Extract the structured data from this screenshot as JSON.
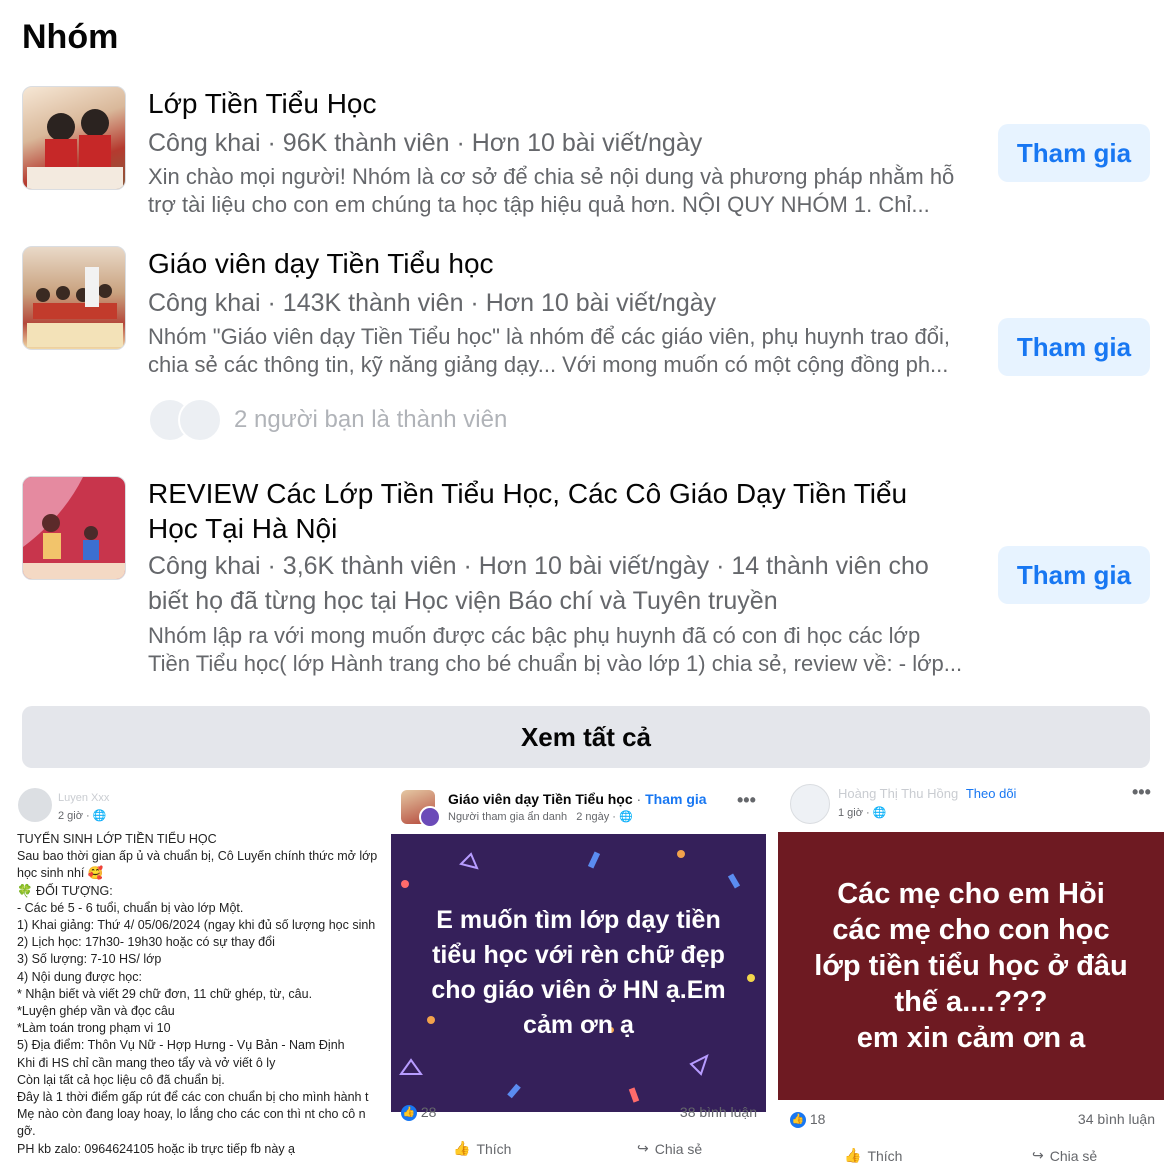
{
  "section": {
    "title": "Nhóm"
  },
  "groups": [
    {
      "name": "Lớp Tiền Tiểu Học",
      "meta": "Công khai · 96K thành viên · Hơn 10 bài viết/ngày",
      "desc1": "Xin chào mọi người! Nhóm là cơ sở để chia sẻ nội dung và phương pháp nhằm hỗ",
      "desc2": "trợ tài liệu cho con em chúng ta học tập hiệu quả hơn. NỘI QUY NHÓM 1. Chỉ...",
      "join": "Tham gia"
    },
    {
      "name": "Giáo viên dạy Tiền Tiểu học",
      "meta": "Công khai · 143K thành viên · Hơn 10 bài viết/ngày",
      "desc1": "Nhóm \"Giáo viên dạy Tiền Tiểu học\" là nhóm để các giáo viên, phụ huynh trao đổi,",
      "desc2": "chia sẻ các thông tin, kỹ năng giảng dạy... Với mong muốn có một cộng đồng ph...",
      "friends": "2 người bạn là thành viên",
      "join": "Tham gia"
    },
    {
      "name1": "REVIEW Các Lớp Tiền Tiểu Học, Các Cô Giáo Dạy Tiền Tiểu",
      "name2": "Học Tại Hà Nội",
      "meta1": "Công khai · 3,6K thành viên · Hơn 10 bài viết/ngày · 14 thành viên cho",
      "meta2": "biết họ đã từng học tại Học viện Báo chí và Tuyên truyền",
      "desc1": "Nhóm lập ra với mong muốn được các bậc phụ huynh đã có con đi học các lớp",
      "desc2": "Tiền Tiểu học( lớp Hành trang cho bé chuẩn bị vào lớp 1) chia sẻ, review về: - lớp...",
      "join": "Tham gia"
    }
  ],
  "see_all": "Xem tất cả",
  "posts": [
    {
      "author": "Luyen Xxx",
      "time": "2 giờ · ",
      "lines": [
        "TUYỂN SINH LỚP TIỀN TIỂU HỌC",
        "Sau bao thời gian ấp ủ và chuẩn bị, Cô Luyến chính thức mở lớp",
        "học sinh nhí 🥰",
        "🍀 ĐỐI TƯỢNG:",
        "- Các bé 5 - 6 tuổi, chuẩn bị vào lớp Một.",
        "1) Khai giảng: Thứ 4/ 05/06/2024 (ngay khi đủ số lượng học sinh",
        "2) Lịch học:  17h30- 19h30 hoặc có sự thay đổi",
        "3) Số lượng: 7-10 HS/ lớp",
        "4) Nội dung được học:",
        "* Nhận biết và viết 29 chữ đơn, 11 chữ ghép, từ, câu.",
        "*Luyện ghép vần và đọc câu",
        "*Làm toán trong phạm vi 10",
        "5) Địa điểm: Thôn Vụ Nữ - Hợp Hưng - Vụ Bản - Nam Định",
        "Khi đi HS chỉ cần mang theo tẩy và vở viết ô ly",
        "Còn lại tất cả học liệu cô đã chuẩn bị.",
        "Đây là 1 thời điểm gấp rút để các con chuẩn bị cho mình hành t",
        "Mẹ nào còn đang loay hoay, lo lắng cho các con  thì nt cho cô n",
        "gỡ.",
        "PH kb zalo: 0964624105 hoặc ib trực tiếp fb này ạ"
      ]
    },
    {
      "group": "Giáo viên dạy Tiền Tiểu học",
      "join": "Tham gia",
      "author": "Người tham gia ẩn danh",
      "time": "2 ngày · ",
      "banner": "E muốn tìm lớp dạy tiền tiểu học với rèn chữ đẹp cho giáo viên ở HN ạ.Em cảm ơn ạ",
      "likes": "28",
      "comments": "38 bình luận",
      "like_label": "Thích",
      "share_label": "Chia sẻ",
      "banner_color": "#35205a"
    },
    {
      "author": "Hoàng Thị Thu Hồng",
      "follow": "Theo dõi",
      "time": "1 giờ · ",
      "banner_l1": "Các mẹ cho em Hỏi",
      "banner_l2": "các mẹ cho con học",
      "banner_l3": "lớp tiền tiểu học ở đâu",
      "banner_l4": "thế a....???",
      "banner_l5": "em xin cảm ơn a",
      "likes": "18",
      "comments": "34 bình luận",
      "like_label": "Thích",
      "share_label": "Chia sẻ",
      "banner_color": "#6e1a22"
    }
  ],
  "colors": {
    "accent": "#1877f2",
    "join_bg": "#e7f3ff",
    "muted": "#65676b"
  }
}
